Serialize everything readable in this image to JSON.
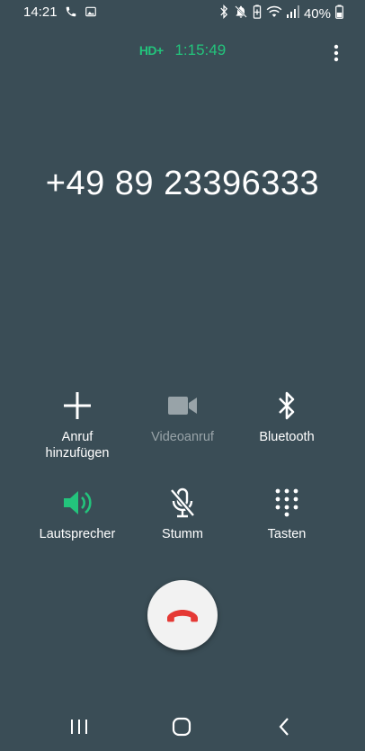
{
  "status_bar": {
    "time": "14:21",
    "battery_percent": "40%"
  },
  "call": {
    "hd_badge": "HD+",
    "duration": "1:15:49",
    "number": "+49 89 23396333"
  },
  "actions": {
    "add_call": {
      "label_line1": "Anruf",
      "label_line2": "hinzufügen"
    },
    "video_call": {
      "label": "Videoanruf",
      "enabled": false
    },
    "bluetooth": {
      "label": "Bluetooth"
    },
    "speaker": {
      "label": "Lautsprecher",
      "active": true
    },
    "mute": {
      "label": "Stumm"
    },
    "keypad": {
      "label": "Tasten"
    }
  },
  "colors": {
    "background": "#3a4d56",
    "accent_green": "#23c47c",
    "end_call_red": "#e53935"
  },
  "icons": [
    "phone-icon",
    "image-icon",
    "bluetooth-icon",
    "mute-notifications-icon",
    "battery-saver-icon",
    "wifi-icon",
    "signal-icon",
    "battery-icon",
    "more-icon",
    "plus-icon",
    "video-camera-icon",
    "speaker-icon",
    "mic-off-icon",
    "dialpad-icon",
    "end-call-icon",
    "recents-icon",
    "home-icon",
    "back-icon"
  ]
}
